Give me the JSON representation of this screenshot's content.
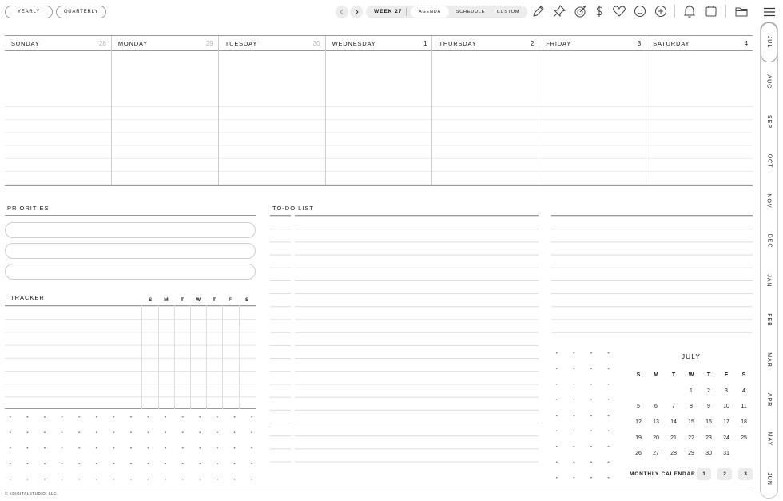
{
  "toolbar": {
    "yearly_label": "YEARLY",
    "quarterly_label": "QUARTERLY",
    "prev_icon": "chevron-left-icon",
    "next_icon": "chevron-right-icon",
    "week_label": "WEEK 27",
    "view_tabs": [
      {
        "label": "AGENDA",
        "active": true
      },
      {
        "label": "SCHEDULE",
        "active": false
      },
      {
        "label": "CUSTOM",
        "active": false
      }
    ],
    "icons": [
      "pencil-icon",
      "pushpin-icon",
      "target-icon",
      "dollar-icon",
      "heart-icon",
      "smiley-icon",
      "plus-circle-icon",
      "bell-icon",
      "calendar-icon",
      "folder-icon",
      "menu-icon"
    ]
  },
  "week": {
    "days": [
      {
        "name": "SUNDAY",
        "num": "28",
        "muted": true
      },
      {
        "name": "MONDAY",
        "num": "29",
        "muted": true
      },
      {
        "name": "TUESDAY",
        "num": "30",
        "muted": true
      },
      {
        "name": "WEDNESDAY",
        "num": "1",
        "muted": false
      },
      {
        "name": "THURSDAY",
        "num": "2",
        "muted": false
      },
      {
        "name": "FRIDAY",
        "num": "3",
        "muted": false
      },
      {
        "name": "SATURDAY",
        "num": "4",
        "muted": false
      }
    ]
  },
  "priorities": {
    "title": "PRIORITIES"
  },
  "tracker": {
    "title": "TRACKER",
    "days": [
      "S",
      "M",
      "T",
      "W",
      "T",
      "F",
      "S"
    ]
  },
  "todo": {
    "title": "TO-DO LIST"
  },
  "mini_calendar": {
    "title": "JULY",
    "weekdays": [
      "S",
      "M",
      "T",
      "W",
      "T",
      "F",
      "S"
    ],
    "cells": [
      "",
      "",
      "",
      "1",
      "2",
      "3",
      "4",
      "5",
      "6",
      "7",
      "8",
      "9",
      "10",
      "11",
      "12",
      "13",
      "14",
      "15",
      "16",
      "17",
      "18",
      "19",
      "20",
      "21",
      "22",
      "23",
      "24",
      "25",
      "26",
      "27",
      "28",
      "29",
      "30",
      "31",
      ""
    ]
  },
  "monthly_calendar": {
    "label": "MONTHLY CALENDAR",
    "buttons": [
      "1",
      "2",
      "3"
    ]
  },
  "footer": {
    "text": "© KDIGITALSTUDIO, LLC"
  },
  "months": {
    "items": [
      "JUL",
      "AUG",
      "SEP",
      "OCT",
      "NOV",
      "DEC",
      "JAN",
      "FEB",
      "MAR",
      "APR",
      "MAY",
      "JUN"
    ],
    "active": "JUL"
  }
}
